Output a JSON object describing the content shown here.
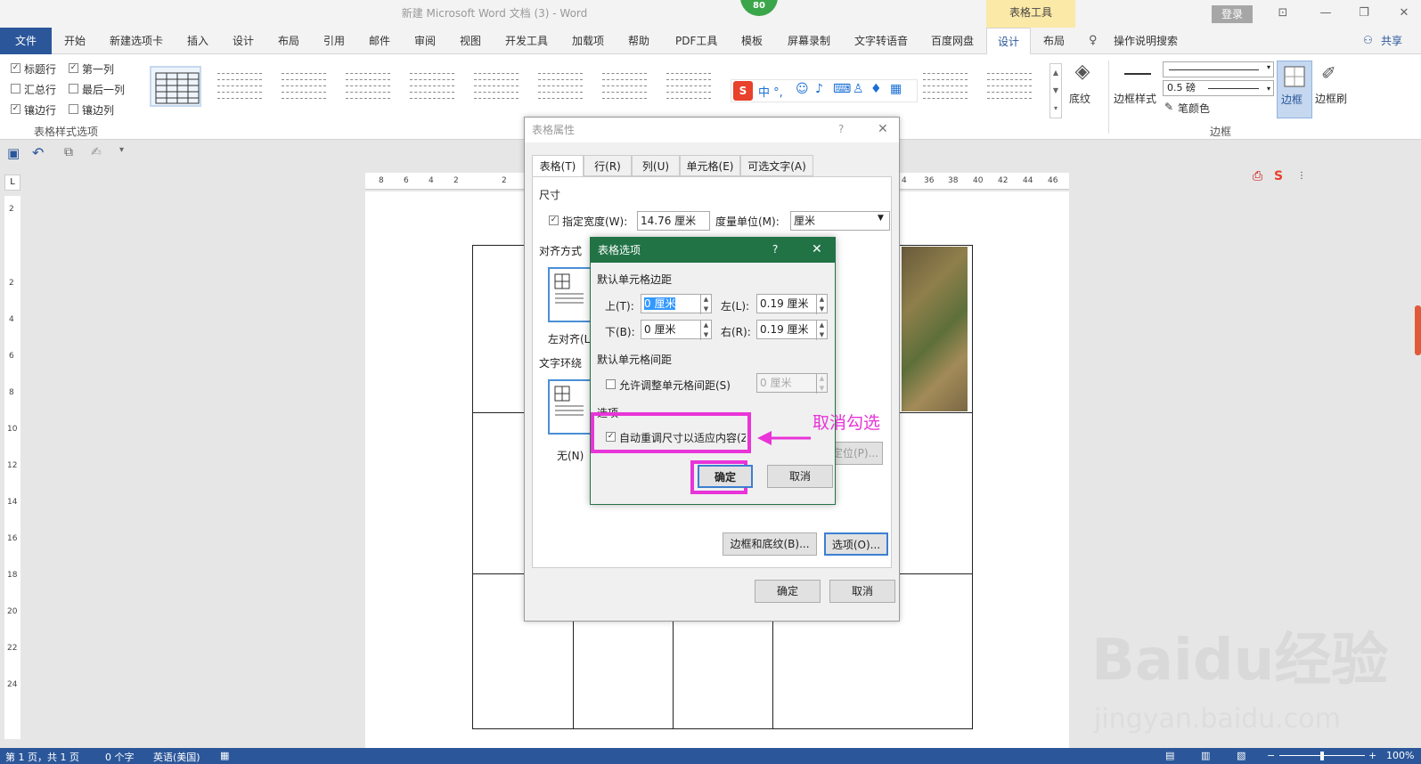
{
  "title_bar": {
    "doc_title": "新建 Microsoft Word 文档 (3)  -  Word",
    "context_tab_group": "表格工具",
    "login_label": "登录",
    "badge": "80",
    "win_buttons": {
      "ribbon_opts": "⊡",
      "minimize": "—",
      "restore": "❐",
      "close": "✕"
    }
  },
  "tabs": {
    "file": "文件",
    "items": [
      "开始",
      "新建选项卡",
      "插入",
      "设计",
      "布局",
      "引用",
      "邮件",
      "审阅",
      "视图",
      "开发工具",
      "加载项",
      "帮助",
      "PDF工具",
      "模板",
      "屏幕录制",
      "文字转语音",
      "百度网盘"
    ],
    "design_ctx": "设计",
    "layout_ctx": "布局",
    "tell_me": "操作说明搜索",
    "share": "共享"
  },
  "ribbon": {
    "style_options": {
      "header_row": {
        "label": "标题行",
        "checked": "✓"
      },
      "first_column": {
        "label": "第一列",
        "checked": "✓"
      },
      "total_row": {
        "label": "汇总行",
        "checked": ""
      },
      "last_column": {
        "label": "最后一列",
        "checked": ""
      },
      "banded_rows": {
        "label": "镶边行",
        "checked": "✓"
      },
      "banded_columns": {
        "label": "镶边列",
        "checked": ""
      },
      "group_label": "表格样式选项"
    },
    "shading_label": "底纹",
    "border_styles_label": "边框样式",
    "pen_weight": "0.5 磅",
    "pen_color_label": "笔颜色",
    "borders_label": "边框",
    "border_painter_label": "边框刷",
    "borders_group_label": "边框",
    "ime_chars": "中 °,"
  },
  "ruler": {
    "h_ticks": [
      "8",
      "6",
      "4",
      "2",
      "2",
      "4",
      "36",
      "38",
      "40",
      "42",
      "44",
      "46"
    ],
    "v_ticks": [
      "2",
      "2",
      "4",
      "6",
      "8",
      "10",
      "12",
      "14",
      "16",
      "18",
      "20",
      "22",
      "24"
    ]
  },
  "table_properties": {
    "title": "表格属性",
    "help": "?",
    "close": "✕",
    "tabs": [
      "表格(T)",
      "行(R)",
      "列(U)",
      "单元格(E)",
      "可选文字(A)"
    ],
    "size_label": "尺寸",
    "preferred_width_label": "指定宽度(W):",
    "preferred_width_checked": "✓",
    "width_value": "14.76 厘米",
    "measure_label": "度量单位(M):",
    "measure_value": "厘米",
    "alignment_label": "对齐方式",
    "align_left_label": "左对齐(L",
    "text_wrap_label": "文字环绕",
    "wrap_none_label": "无(N)",
    "positioning_label": "定位(P)...",
    "borders_shading_btn": "边框和底纹(B)...",
    "options_btn": "选项(O)...",
    "ok": "确定",
    "cancel": "取消"
  },
  "table_options": {
    "title": "表格选项",
    "help": "?",
    "close": "✕",
    "default_margins_label": "默认单元格边距",
    "top_label": "上(T):",
    "top_value": "0 厘米",
    "left_label": "左(L):",
    "left_value": "0.19 厘米",
    "bottom_label": "下(B):",
    "bottom_value": "0 厘米",
    "right_label": "右(R):",
    "right_value": "0.19 厘米",
    "default_spacing_label": "默认单元格间距",
    "allow_spacing_label": "允许调整单元格间距(S)",
    "allow_spacing_checked": "",
    "spacing_value": "0 厘米",
    "options_label": "选项",
    "autoresize_label": "自动重调尺寸以适应内容(Z)",
    "autoresize_checked": "✓",
    "ok": "确定",
    "cancel": "取消"
  },
  "annotation": {
    "text": "取消勾选",
    "color": "#e834d8"
  },
  "status_bar": {
    "page": "第 1 页，共 1 页",
    "words": "0 个字",
    "language": "英语(美国)",
    "zoom": "100%"
  },
  "watermark": {
    "main": "Baidu经验",
    "sub": "jingyan.baidu.com"
  },
  "colors": {
    "word_blue": "#2b579a",
    "dialog_green": "#217346",
    "highlight": "#e834d8"
  }
}
